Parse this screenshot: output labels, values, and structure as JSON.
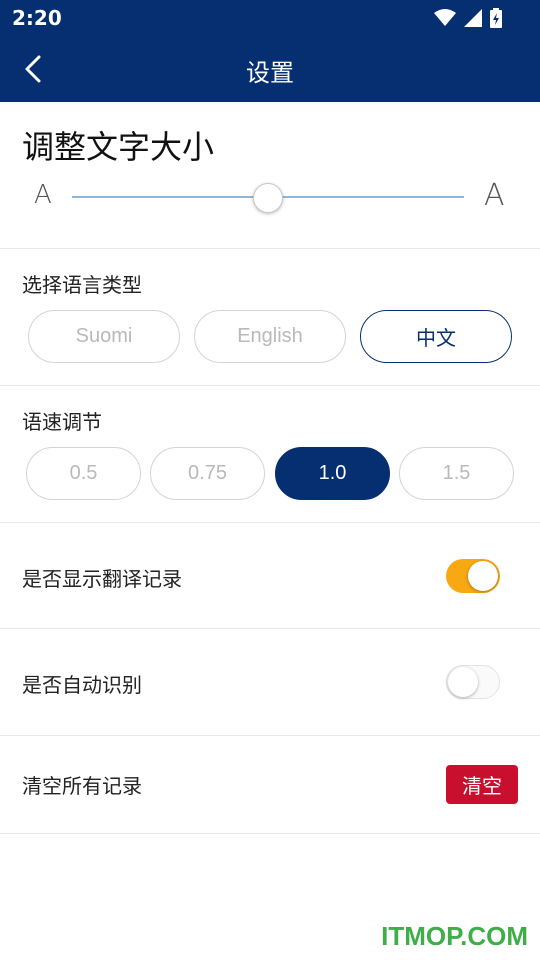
{
  "status_bar": {
    "time": "2:20"
  },
  "app_bar": {
    "title": "设置"
  },
  "font_size": {
    "title": "调整文字大小",
    "small_label": "A",
    "large_label": "A",
    "level": 0.5
  },
  "language": {
    "label": "选择语言类型",
    "options": [
      "Suomi",
      "English",
      "中文"
    ],
    "selected": "中文"
  },
  "speed": {
    "label": "语速调节",
    "options": [
      "0.5",
      "0.75",
      "1.0",
      "1.5"
    ],
    "selected": "1.0"
  },
  "show_history": {
    "label": "是否显示翻译记录",
    "enabled": true
  },
  "auto_recognize": {
    "label": "是否自动识别",
    "enabled": false
  },
  "clear_records": {
    "label": "清空所有记录",
    "button_label": "清空"
  },
  "colors": {
    "primary": "#062f71",
    "toggle_on": "#f7a813",
    "danger": "#c8102e"
  },
  "watermark": "ITMOP.COM"
}
